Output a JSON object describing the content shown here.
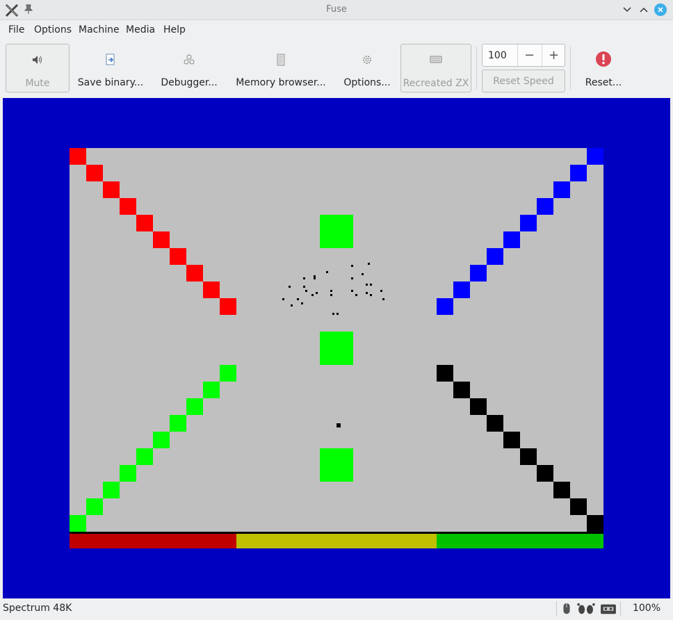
{
  "window": {
    "title": "Fuse"
  },
  "menu": {
    "items": [
      "File",
      "Options",
      "Machine",
      "Media",
      "Help"
    ]
  },
  "toolbar": {
    "mute_label": "Mute",
    "save_binary_label": "Save binary...",
    "debugger_label": "Debugger...",
    "memory_browser_label": "Memory browser...",
    "options_label": "Options...",
    "recreated_zx_label": "Recreated ZX",
    "speed_value": "100",
    "speed_minus": "−",
    "speed_plus": "+",
    "reset_speed_label": "Reset Speed",
    "reset_label": "Reset..."
  },
  "display": {
    "colors": {
      "border": "#0000c0",
      "paper": "#c0c0c0",
      "red": "#ff0000",
      "blue": "#0000ff",
      "green": "#00ff00",
      "black": "#000000",
      "bar_red": "#c00000",
      "bar_yellow": "#c0c000",
      "bar_green": "#00c000"
    },
    "icons": [
      "app-x-icon",
      "pin-icon",
      "speaker-icon",
      "save-icon",
      "debugger-icon",
      "memory-icon",
      "gear-icon",
      "keyboard-icon",
      "error-icon"
    ]
  },
  "status": {
    "machine": "Spectrum 48K",
    "zoom": "100%"
  }
}
